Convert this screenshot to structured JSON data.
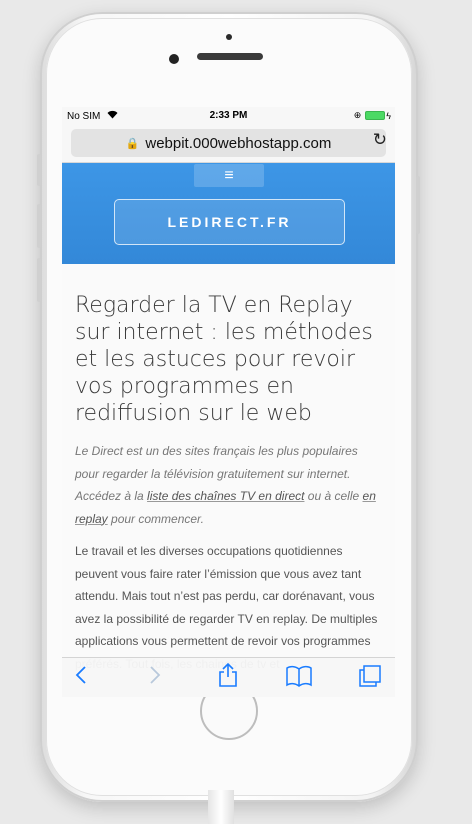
{
  "status": {
    "carrier": "No SIM",
    "time": "2:33 PM"
  },
  "url": {
    "domain": "webpit.000webhostapp.com"
  },
  "site": {
    "menu_icon": "≡",
    "logo": "LEDIRECT.FR"
  },
  "article": {
    "title": "Regarder la TV en Replay sur internet : les méthodes et les astuces pour revoir vos programmes en rediffusion sur le web",
    "lead_part1": "Le Direct est un des sites français les plus populaires pour regarder la télévision gratuitement sur internet. Accédez à la ",
    "lead_link1": "liste des chaînes TV en direct",
    "lead_part2": " ou à celle ",
    "lead_link2": "en replay",
    "lead_part3": " pour commencer.",
    "body": "Le travail et les diverses occupations quotidiennes peuvent vous faire rater l’émission que vous avez tant attendu. Mais tout n’est pas perdu, car dorénavant, vous avez la possibilité de regarder TV en replay. De multiples applications vous permettent de revoir vos programmes préférés. Tout fois, les chaines de tv et"
  },
  "toolbar": {
    "back_icon": "chevron-left-icon",
    "forward_icon": "chevron-right-icon",
    "share_icon": "share-icon",
    "bookmarks_icon": "book-icon",
    "tabs_icon": "tabs-icon"
  },
  "colors": {
    "banner": "#3388d8",
    "ios_blue": "#1a7cff"
  }
}
